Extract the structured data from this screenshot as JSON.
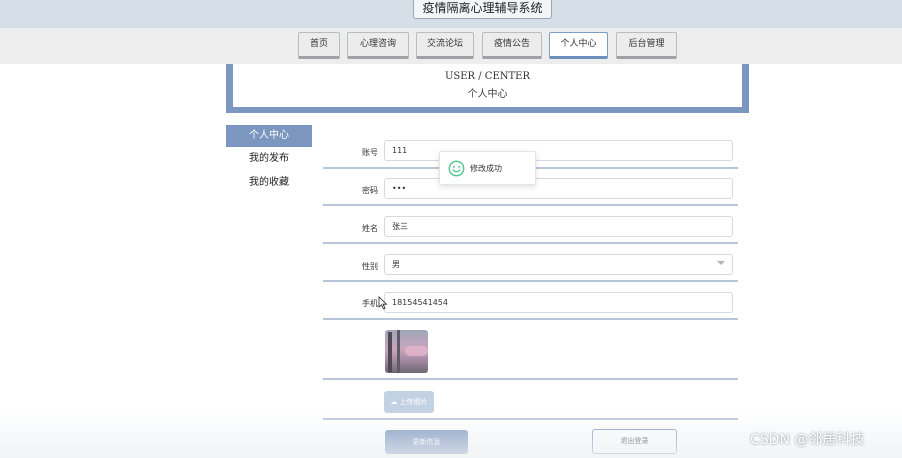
{
  "header": {
    "title": "疫情隔离心理辅导系统"
  },
  "nav": {
    "items": [
      {
        "label": "首页"
      },
      {
        "label": "心理咨询"
      },
      {
        "label": "交流论坛"
      },
      {
        "label": "疫情公告"
      },
      {
        "label": "个人中心"
      },
      {
        "label": "后台管理"
      }
    ],
    "active_index": 4
  },
  "banner": {
    "en": "USER / CENTER",
    "cn": "个人中心"
  },
  "sidebar": {
    "items": [
      {
        "label": "个人中心"
      },
      {
        "label": "我的发布"
      },
      {
        "label": "我的收藏"
      }
    ],
    "active_index": 0
  },
  "form": {
    "account": {
      "label": "账号",
      "value": "111"
    },
    "password": {
      "label": "密码",
      "value": "•••"
    },
    "name": {
      "label": "姓名",
      "value": "张三"
    },
    "gender": {
      "label": "性别",
      "value": "男"
    },
    "phone": {
      "label": "手机",
      "value": "18154541454"
    },
    "upload_label": "上传图片",
    "update_label": "更新信息",
    "logout_label": "退出登录"
  },
  "toast": {
    "text": "修改成功",
    "icon": "smile-icon"
  },
  "watermark": {
    "text": "CSDN @邻居科技"
  },
  "colors": {
    "accent": "#7b97bf",
    "topbar": "#d6dee8",
    "navbar": "#ededed"
  }
}
